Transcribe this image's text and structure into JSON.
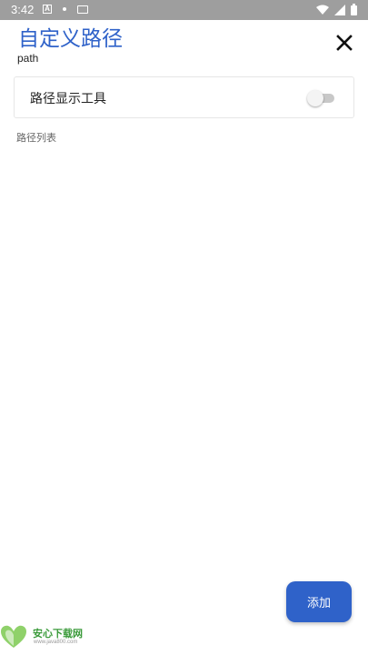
{
  "status_bar": {
    "time": "3:42",
    "left_icons": [
      "a-icon",
      "dot-icon",
      "cast-icon"
    ],
    "right_icons": [
      "wifi-icon",
      "signal-icon",
      "battery-icon"
    ]
  },
  "header": {
    "title": "自定义路径",
    "subtitle": "path",
    "close_icon": "close-icon"
  },
  "tool_card": {
    "label": "路径显示工具",
    "toggle_on": false
  },
  "list": {
    "section_label": "路径列表",
    "items": []
  },
  "fab": {
    "label": "添加"
  },
  "watermark": {
    "name": "安心下载网",
    "url": "www.java800.com"
  },
  "colors": {
    "accent": "#2f62c9",
    "status_bar": "#9e9e9e",
    "watermark_green": "#3a9a3a"
  }
}
